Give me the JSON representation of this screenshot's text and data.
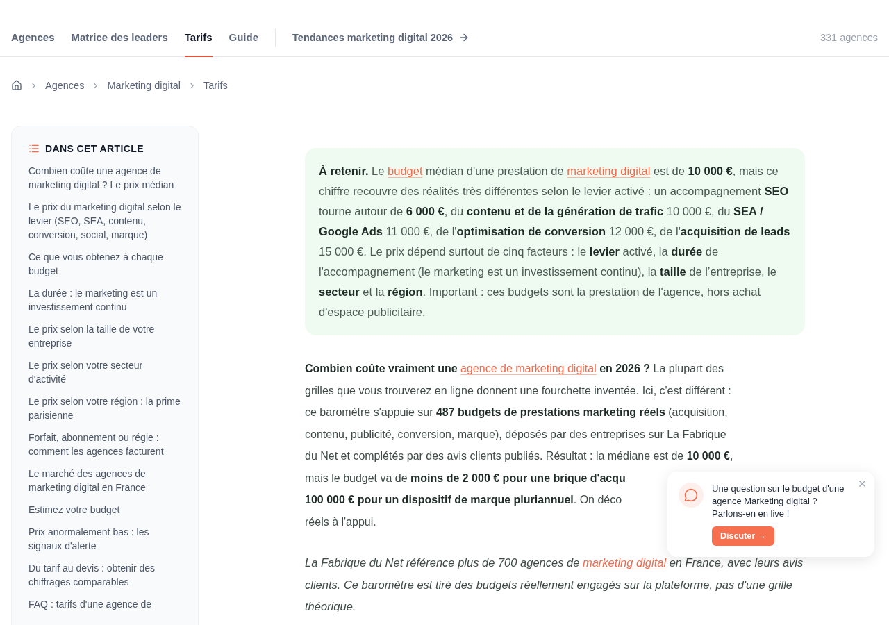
{
  "nav": {
    "tabs": [
      {
        "label": "Agences",
        "selected": false
      },
      {
        "label": "Matrice des leaders",
        "selected": false
      },
      {
        "label": "Tarifs",
        "selected": true
      },
      {
        "label": "Guide",
        "selected": false
      }
    ],
    "feature_link": "Tendances marketing digital 2026",
    "count": "331 agences"
  },
  "breadcrumb": [
    "Agences",
    "Marketing digital",
    "Tarifs"
  ],
  "toc": {
    "title": "DANS CET ARTICLE",
    "items": [
      "Combien coûte une agence de marketing digital ? Le prix médian",
      "Le prix du marketing digital selon le levier (SEO, SEA, contenu, conversion, social, marque)",
      "Ce que vous obtenez à chaque budget",
      "La durée : le marketing est un investissement continu",
      "Le prix selon la taille de votre entreprise",
      "Le prix selon votre secteur d'activité",
      "Le prix selon votre région : la prime parisienne",
      "Forfait, abonnement ou régie : comment les agences facturent",
      "Le marché des agences de marketing digital en France",
      "Estimez votre budget",
      "Prix anormalement bas : les signaux d'alerte",
      "Du tarif au devis : obtenir des chiffrages comparables",
      "FAQ : tarifs d'une agence de"
    ]
  },
  "summary": [
    {
      "kind": "text",
      "text": "**À retenir.** Le "
    },
    {
      "kind": "link",
      "text": "budget"
    },
    {
      "kind": "text",
      "text": " médian d'une prestation de "
    },
    {
      "kind": "link",
      "text": "marketing digital"
    },
    {
      "kind": "text",
      "text": " est de **10 000 €**, mais ce chiffre recouvre des réalités très différentes selon le levier activé : un accompagnement **SEO** tourne autour de **6 000 €**, du **contenu et de la génération de trafic** 10 000 €, du **SEA / Google Ads** 11 000 €, de l'**optimisation de conversion** 12 000 €, de l'**acquisition de leads** 15 000 €. Le prix dépend surtout de cinq facteurs : le **levier** activé, la **durée** de l'accompagnement (le marketing est un investissement continu), la **taille** de l’entreprise, le **secteur** et la **région**. Important : ces budgets sont la prestation de l'agence, hors achat d'espace publicitaire."
    }
  ],
  "intro_lines": [
    [
      {
        "kind": "text",
        "text": "**Combien coûte vraiment une** "
      },
      {
        "kind": "link",
        "text": "agence de marketing digital"
      },
      {
        "kind": "text",
        "text": " **en 2026 ?** La plupart des"
      }
    ],
    [
      {
        "kind": "text",
        "text": "grilles que vous trouverez en ligne donnent une fourchette inventée. Ici, c'est différent :"
      }
    ],
    [
      {
        "kind": "text",
        "text": "ce baromètre s'appuie sur **487 budgets de prestations marketing réels** (acquisition,"
      }
    ],
    [
      {
        "kind": "text",
        "text": "contenu, publicité, conversion, marque), déposés par des entreprises sur La Fabrique"
      }
    ],
    [
      {
        "kind": "text",
        "text": "du Net et complétés par des avis clients publiés. Résultat : la médiane est de **10 000 €**,"
      }
    ],
    [
      {
        "kind": "text",
        "text": "mais le budget va de **moins de 2 000 € pour une brique d'acqu**"
      }
    ],
    [
      {
        "kind": "text",
        "text": "**100 000 € pour un dispositif de marque pluriannuel**. On déco"
      }
    ],
    [
      {
        "kind": "text",
        "text": "réels à l'appui."
      }
    ]
  ],
  "note": [
    {
      "kind": "text",
      "text": "La Fabrique du Net référence plus de 700 agences de "
    },
    {
      "kind": "link",
      "text": "marketing digital"
    },
    {
      "kind": "text",
      "text": " en France, avec leurs avis clients. Ce baromètre est tiré des budgets réellement engagés sur la plateforme, pas d'une grille théorique."
    }
  ],
  "chat": {
    "message": "Une question sur le budget d'une agence Marketing digital ? Parlons-en en live !",
    "button": "Discuter →"
  }
}
